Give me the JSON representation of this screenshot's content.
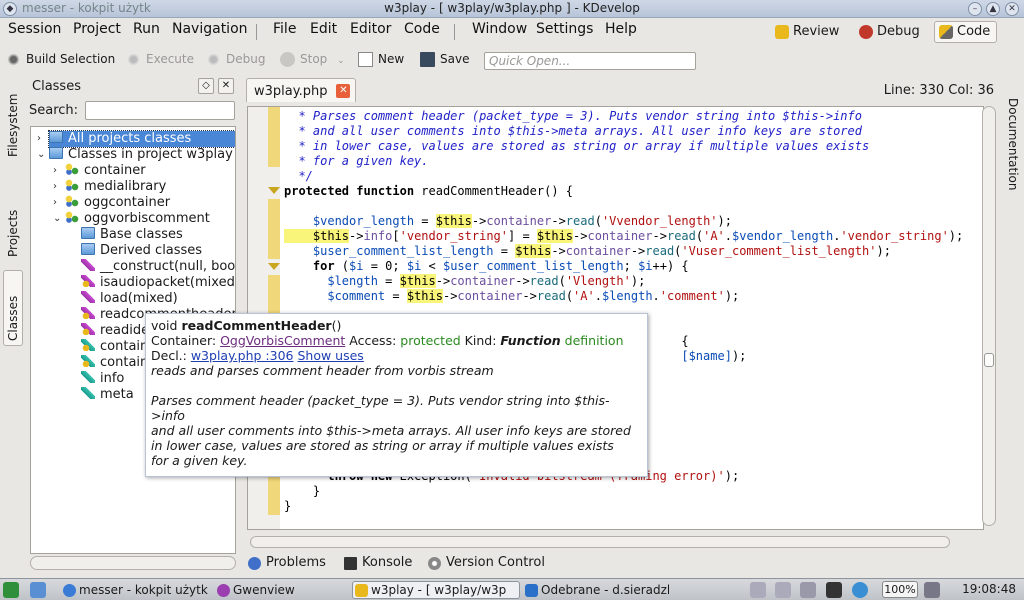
{
  "window": {
    "title": "w3play - [ w3play/w3play.php ] - KDevelop",
    "bg_tab": "messer - kokpit użytk"
  },
  "menu": [
    "Session",
    "Project",
    "Run",
    "Navigation",
    "File",
    "Edit",
    "Editor",
    "Code",
    "Window",
    "Settings",
    "Help"
  ],
  "perspectives": [
    {
      "label": "Review",
      "icon": "review-icon"
    },
    {
      "label": "Debug",
      "icon": "bug-icon"
    },
    {
      "label": "Code",
      "icon": "code-icon",
      "active": true
    }
  ],
  "toolbar": {
    "build": "Build Selection",
    "execute": "Execute",
    "debug": "Debug",
    "stop": "Stop",
    "new": "New",
    "save": "Save",
    "quick_open_placeholder": "Quick Open..."
  },
  "left_tabs": [
    "Filesystem",
    "Projects",
    "Classes"
  ],
  "right_tabs": [
    "Documentation"
  ],
  "classes_panel": {
    "title": "Classes",
    "search_label": "Search:",
    "tree": [
      {
        "label": "All projects classes",
        "icon": "folder",
        "depth": 0,
        "arrow": ">",
        "selected": true
      },
      {
        "label": "Classes in project w3play",
        "icon": "folder",
        "depth": 0,
        "arrow": "v"
      },
      {
        "label": "container",
        "icon": "class",
        "depth": 1,
        "arrow": ">"
      },
      {
        "label": "medialibrary",
        "icon": "class",
        "depth": 1,
        "arrow": ">"
      },
      {
        "label": "oggcontainer",
        "icon": "class",
        "depth": 1,
        "arrow": ">"
      },
      {
        "label": "oggvorbiscomment",
        "icon": "class",
        "depth": 1,
        "arrow": "v"
      },
      {
        "label": "Base classes",
        "icon": "folder",
        "depth": 2,
        "arrow": ""
      },
      {
        "label": "Derived classes",
        "icon": "folder",
        "depth": 2,
        "arrow": ""
      },
      {
        "label": "__construct(null, bool)",
        "icon": "fn",
        "depth": 2,
        "arrow": ""
      },
      {
        "label": "isaudiopacket(mixed)",
        "icon": "fn2",
        "depth": 2,
        "arrow": ""
      },
      {
        "label": "load(mixed)",
        "icon": "fn",
        "depth": 2,
        "arrow": ""
      },
      {
        "label": "readcommentheader()",
        "icon": "fn2",
        "depth": 2,
        "arrow": "",
        "hl": true
      },
      {
        "label": "readidentificationheader()",
        "icon": "fn2",
        "depth": 2,
        "arrow": ""
      },
      {
        "label": "container",
        "icon": "var2",
        "depth": 2,
        "arrow": ""
      },
      {
        "label": "container",
        "icon": "var2",
        "depth": 2,
        "arrow": ""
      },
      {
        "label": "info",
        "icon": "var",
        "depth": 2,
        "arrow": ""
      },
      {
        "label": "meta",
        "icon": "var",
        "depth": 2,
        "arrow": ""
      }
    ]
  },
  "editor": {
    "file_tab": "w3play.php",
    "line_col": "Line: 330 Col: 36",
    "lines": [
      [
        [
          "k-cmt",
          "  * Parses comment header (packet_type = 3). Puts vendor string into $this->info"
        ]
      ],
      [
        [
          "k-cmt",
          "  * and all user comments into $this->meta arrays. All user info keys are stored"
        ]
      ],
      [
        [
          "k-cmt",
          "  * in lower case, values are stored as string or array if multiple values exists"
        ]
      ],
      [
        [
          "k-cmt",
          "  * for a given key."
        ]
      ],
      [
        [
          "k-cmt",
          "  */"
        ]
      ],
      [
        [
          "k-kw",
          "protected function "
        ],
        [
          "k-fn",
          "readCommentHeader() {"
        ]
      ],
      [
        [
          "k-fn",
          ""
        ]
      ],
      [
        [
          "k-var",
          "    $vendor_length"
        ],
        [
          "k-fn",
          " = "
        ],
        [
          "k-this",
          "$this"
        ],
        [
          "k-fn",
          "->"
        ],
        [
          "k-mem",
          "container"
        ],
        [
          "k-fn",
          "->"
        ],
        [
          "k-call",
          "read"
        ],
        [
          "k-fn",
          "("
        ],
        [
          "k-str",
          "'Vvendor_length'"
        ],
        [
          "k-fn",
          ");"
        ]
      ],
      [
        [
          "k-this",
          "    $this"
        ],
        [
          "k-fn",
          "->"
        ],
        [
          "k-mem",
          "info"
        ],
        [
          "k-fn",
          "["
        ],
        [
          "k-str",
          "'vendor_string'"
        ],
        [
          "k-fn",
          "] = "
        ],
        [
          "k-this",
          "$this"
        ],
        [
          "k-fn",
          "->"
        ],
        [
          "k-mem",
          "container"
        ],
        [
          "k-fn",
          "->"
        ],
        [
          "k-call",
          "read"
        ],
        [
          "k-fn",
          "("
        ],
        [
          "k-str",
          "'A'"
        ],
        [
          "k-fn",
          "."
        ],
        [
          "k-var",
          "$vendor_length"
        ],
        [
          "k-fn",
          "."
        ],
        [
          "k-str",
          "'vendor_string'"
        ],
        [
          "k-fn",
          ");"
        ]
      ],
      [
        [
          "k-var",
          "    $user_comment_list_length"
        ],
        [
          "k-fn",
          " = "
        ],
        [
          "k-this",
          "$this"
        ],
        [
          "k-fn",
          "->"
        ],
        [
          "k-mem",
          "container"
        ],
        [
          "k-fn",
          "->"
        ],
        [
          "k-call",
          "read"
        ],
        [
          "k-fn",
          "("
        ],
        [
          "k-str",
          "'Vuser_comment_list_length'"
        ],
        [
          "k-fn",
          ");"
        ]
      ],
      [
        [
          "k-kw",
          "    for "
        ],
        [
          "k-fn",
          "("
        ],
        [
          "k-var",
          "$i"
        ],
        [
          "k-fn",
          " = 0; "
        ],
        [
          "k-var",
          "$i"
        ],
        [
          "k-fn",
          " < "
        ],
        [
          "k-var",
          "$user_comment_list_length"
        ],
        [
          "k-fn",
          "; "
        ],
        [
          "k-var",
          "$i"
        ],
        [
          "k-fn",
          "++) {"
        ]
      ],
      [
        [
          "k-var",
          "      $length"
        ],
        [
          "k-fn",
          " = "
        ],
        [
          "k-this",
          "$this"
        ],
        [
          "k-fn",
          "->"
        ],
        [
          "k-mem",
          "container"
        ],
        [
          "k-fn",
          "->"
        ],
        [
          "k-call",
          "read"
        ],
        [
          "k-fn",
          "("
        ],
        [
          "k-str",
          "'Vlength'"
        ],
        [
          "k-fn",
          ");"
        ]
      ],
      [
        [
          "k-var",
          "      $comment"
        ],
        [
          "k-fn",
          " = "
        ],
        [
          "k-this",
          "$this"
        ],
        [
          "k-fn",
          "->"
        ],
        [
          "k-mem",
          "container"
        ],
        [
          "k-fn",
          "->"
        ],
        [
          "k-call",
          "read"
        ],
        [
          "k-fn",
          "("
        ],
        [
          "k-str",
          "'A'"
        ],
        [
          "k-fn",
          "."
        ],
        [
          "k-var",
          "$length"
        ],
        [
          "k-fn",
          "."
        ],
        [
          "k-str",
          "'comment'"
        ],
        [
          "k-fn",
          ");"
        ]
      ],
      [
        [
          "k-fn",
          ""
        ]
      ],
      [
        [
          "k-fn",
          ""
        ]
      ],
      [
        [
          "k-fn",
          "                                                       {"
        ]
      ],
      [
        [
          "k-fn",
          "                                                       "
        ],
        [
          "k-var",
          "[$name]"
        ],
        [
          "k-fn",
          ");"
        ]
      ],
      [
        [
          "k-fn",
          ""
        ]
      ],
      [
        [
          "k-fn",
          ""
        ]
      ],
      [
        [
          "k-fn",
          ""
        ]
      ],
      [
        [
          "k-fn",
          ""
        ]
      ],
      [
        [
          "k-fn",
          ""
        ]
      ],
      [
        [
          "k-fn",
          ""
        ]
      ],
      [
        [
          "k-fn",
          "                                               ) {"
        ]
      ],
      [
        [
          "k-kw",
          "      throw new "
        ],
        [
          "k-fn",
          "Exception("
        ],
        [
          "k-str",
          "'Invalid bitstream (framing error)'"
        ],
        [
          "k-fn",
          ");"
        ]
      ],
      [
        [
          "k-fn",
          "    }"
        ]
      ],
      [
        [
          "k-fn",
          "}"
        ]
      ]
    ]
  },
  "tooltip": {
    "sig_type": "void ",
    "sig_name": "readCommentHeader",
    "sig_args": "()",
    "container_label": "Container: ",
    "container_value": "OggVorbisComment",
    "access_label": " Access: ",
    "access_value": "protected",
    "kind_label": " Kind: ",
    "kind_value": "Function",
    "kind_suffix": " definition",
    "decl_label": "Decl.: ",
    "decl_value": "w3play.php :306",
    "show_uses": "Show uses",
    "brief": "reads and parses comment header from vorbis stream",
    "desc1": "Parses comment header (packet_type = 3). Puts vendor string into $this->info",
    "desc2": "and all user comments into $this->meta arrays. All user info keys are stored",
    "desc3": "in lower case, values are stored as string or array if multiple values exists",
    "desc4": "for a given key."
  },
  "bottom_tabs": [
    "Problems",
    "Konsole",
    "Version Control"
  ],
  "taskbar": {
    "tasks": [
      "messer - kokpit użytk",
      "Gwenview",
      "w3play - [ w3play/w3p",
      "Odebrane - d.sieradzl"
    ],
    "battery": "100%",
    "clock": "19:08:48"
  },
  "colors": {
    "accent": "#4a86d6",
    "tooltip_link": "#6b2c7f",
    "access": "#2a8a1f"
  }
}
